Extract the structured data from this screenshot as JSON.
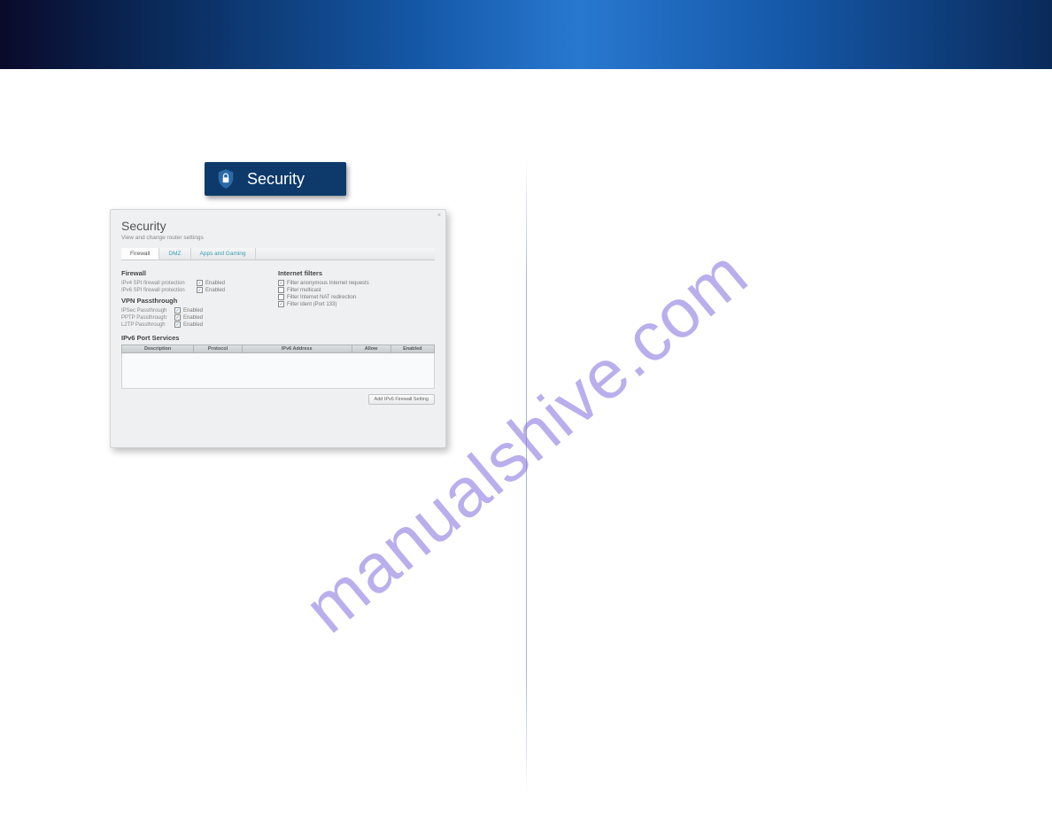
{
  "watermark": "manualshive.com",
  "badge": {
    "label": "Security"
  },
  "panel": {
    "title": "Security",
    "subtitle": "View and change router settings",
    "tabs": [
      "Firewall",
      "DMZ",
      "Apps and Gaming"
    ],
    "firewall": {
      "heading": "Firewall",
      "rows": [
        {
          "label": "IPv4 SPI firewall protection",
          "value": "Enabled",
          "checked": true
        },
        {
          "label": "IPv6 SPI firewall protection",
          "value": "Enabled",
          "checked": true
        }
      ]
    },
    "vpn": {
      "heading": "VPN Passthrough",
      "rows": [
        {
          "label": "IPSec Passthrough",
          "value": "Enabled",
          "checked": true
        },
        {
          "label": "PPTP Passthrough",
          "value": "Enabled",
          "checked": true
        },
        {
          "label": "L2TP Passthrough",
          "value": "Enabled",
          "checked": true
        }
      ]
    },
    "filters": {
      "heading": "Internet filters",
      "rows": [
        {
          "label": "Filter anonymous Internet requests",
          "checked": true
        },
        {
          "label": "Filter multicast",
          "checked": false
        },
        {
          "label": "Filter Internet NAT redirection",
          "checked": false
        },
        {
          "label": "Filter ident (Port 133)",
          "checked": true
        }
      ]
    },
    "ipv6": {
      "heading": "IPv6 Port Services",
      "columns": [
        "Description",
        "Protocol",
        "IPv6 Address",
        "Allow",
        "Enabled"
      ]
    },
    "footer_button": "Add IPv6 Firewall Setting"
  }
}
